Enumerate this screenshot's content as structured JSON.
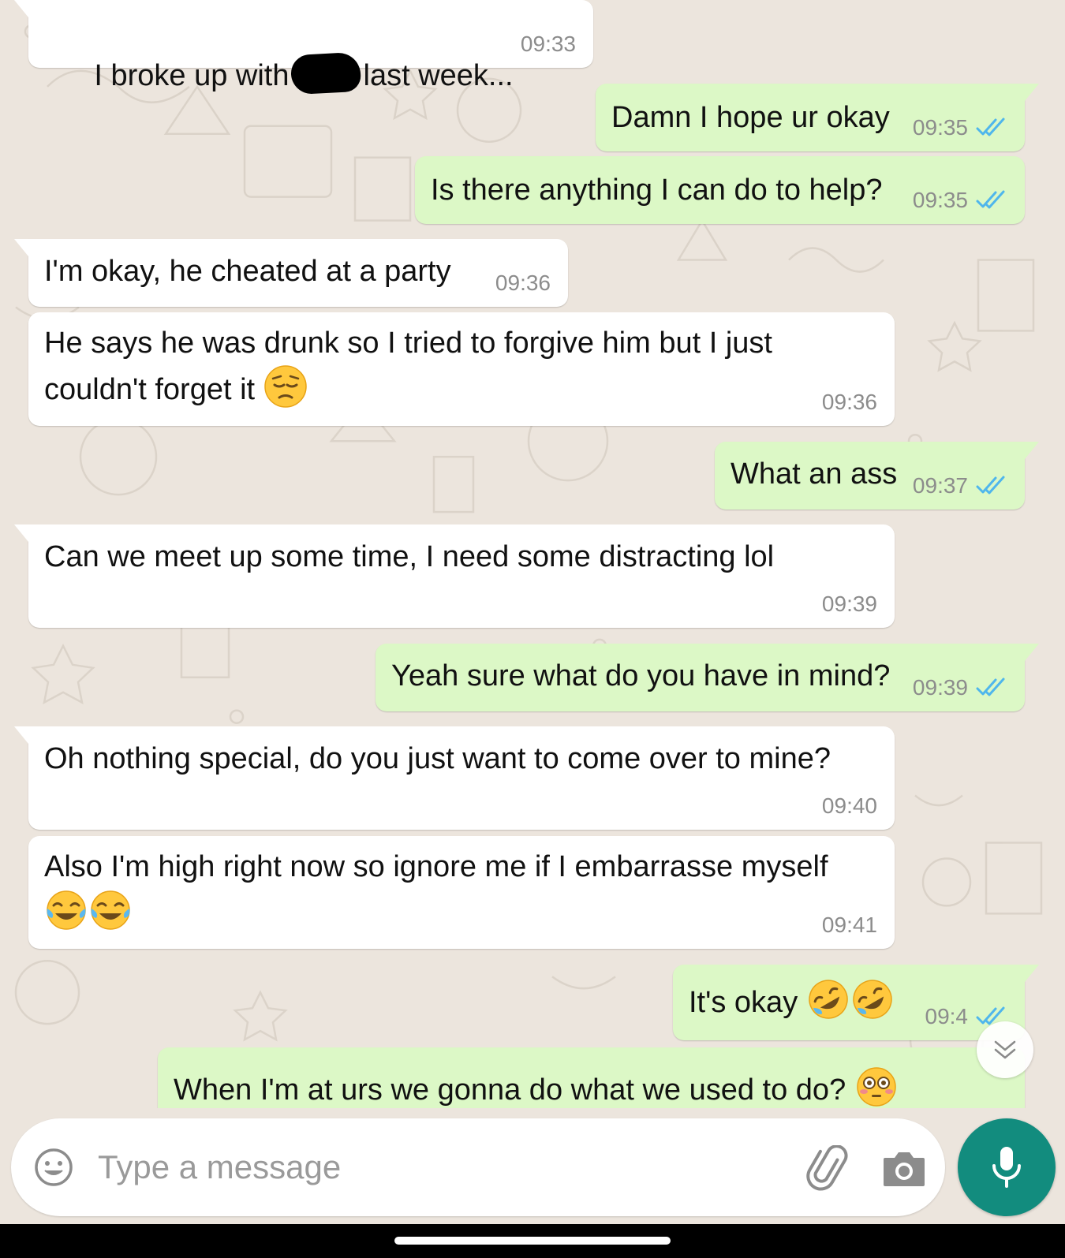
{
  "messages": [
    {
      "dir": "in",
      "tail": true,
      "text_before": "I broke up with",
      "text_after": "last week...",
      "time": "09:33",
      "redacted": true
    },
    {
      "dir": "out",
      "tail": true,
      "text": "Damn I hope ur okay",
      "time": "09:35",
      "status": "read"
    },
    {
      "dir": "out",
      "tail": false,
      "text": "Is there anything I can do to help?",
      "time": "09:35",
      "status": "read"
    },
    {
      "dir": "in",
      "tail": true,
      "text": "I'm okay, he cheated at a party",
      "time": "09:36"
    },
    {
      "dir": "in",
      "tail": false,
      "text": "He says he was drunk so I tried to forgive him but I just couldn't forget it",
      "emoji": [
        "pensive-face"
      ],
      "time": "09:36"
    },
    {
      "dir": "out",
      "tail": true,
      "text": "What an ass",
      "time": "09:37",
      "status": "read"
    },
    {
      "dir": "in",
      "tail": true,
      "text": "Can we meet up some time, I need some distracting lol",
      "time": "09:39"
    },
    {
      "dir": "out",
      "tail": true,
      "text": "Yeah sure what do you have in mind?",
      "time": "09:39",
      "status": "read"
    },
    {
      "dir": "in",
      "tail": true,
      "text": "Oh nothing special, do you just want to come over to mine?",
      "time": "09:40"
    },
    {
      "dir": "in",
      "tail": false,
      "text": "Also I'm high right now so ignore me if I embarrasse myself",
      "emoji": [
        "tears-of-joy",
        "tears-of-joy"
      ],
      "time": "09:41"
    },
    {
      "dir": "out",
      "tail": true,
      "text": "It's okay",
      "emoji": [
        "rofl",
        "rofl"
      ],
      "time": "09:4",
      "status": "read"
    },
    {
      "dir": "out",
      "tail": false,
      "text": "When I'm at urs we gonna do what we used to do?",
      "emoji": [
        "flushed-face"
      ],
      "time": ""
    }
  ],
  "composer": {
    "placeholder": "Type a message",
    "icons": [
      "smile-icon",
      "attach-icon",
      "camera-icon",
      "mic-icon"
    ]
  },
  "colors": {
    "background": "#ECE5DD",
    "incoming": "#FFFFFF",
    "outgoing": "#DCF8C6",
    "read_ticks": "#4FB6EC",
    "accent": "#128C7E"
  }
}
